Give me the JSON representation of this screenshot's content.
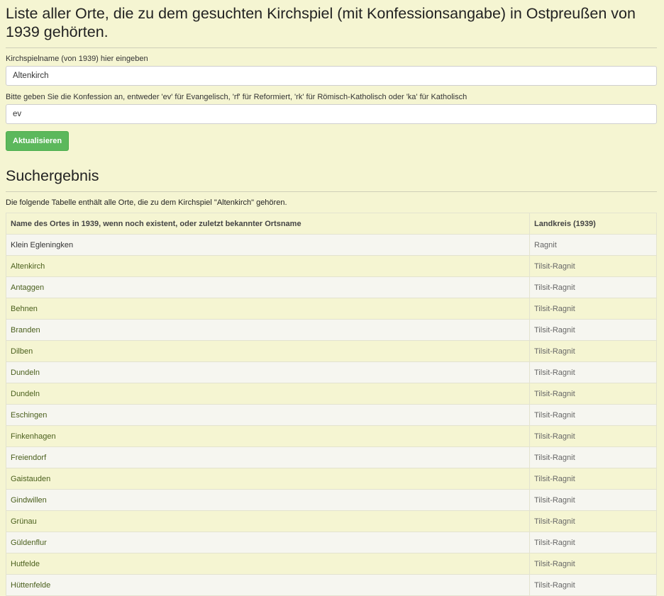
{
  "page": {
    "title": "Liste aller Orte, die zu dem gesuchten Kirchspiel (mit Konfessionsangabe) in Ostpreußen von 1939 gehörten."
  },
  "form": {
    "kirchspiel_label": "Kirchspielname (von 1939) hier eingeben",
    "kirchspiel_value": "Altenkirch",
    "konfession_label": "Bitte geben Sie die Konfession an, entweder 'ev' für Evangelisch, 'rf' für Reformiert, 'rk' für Römisch-Katholisch oder 'ka' für Katholisch",
    "konfession_value": "ev",
    "submit_label": "Aktualisieren"
  },
  "results": {
    "title": "Suchergebnis",
    "intro": "Die folgende Tabelle enthält alle Orte, die zu dem Kirchspiel \"Altenkirch\" gehören.",
    "columns": [
      "Name des Ortes in 1939, wenn noch existent, oder zuletzt bekannter Ortsname",
      "Landkreis (1939)"
    ],
    "rows": [
      {
        "name": "Klein Egleningken",
        "kreis": "Ragnit"
      },
      {
        "name": "Altenkirch",
        "kreis": "Tilsit-Ragnit"
      },
      {
        "name": "Antaggen",
        "kreis": "Tilsit-Ragnit"
      },
      {
        "name": "Behnen",
        "kreis": "Tilsit-Ragnit"
      },
      {
        "name": "Branden",
        "kreis": "Tilsit-Ragnit"
      },
      {
        "name": "Dilben",
        "kreis": "Tilsit-Ragnit"
      },
      {
        "name": "Dundeln",
        "kreis": "Tilsit-Ragnit"
      },
      {
        "name": "Dundeln",
        "kreis": "Tilsit-Ragnit"
      },
      {
        "name": "Eschingen",
        "kreis": "Tilsit-Ragnit"
      },
      {
        "name": "Finkenhagen",
        "kreis": "Tilsit-Ragnit"
      },
      {
        "name": "Freiendorf",
        "kreis": "Tilsit-Ragnit"
      },
      {
        "name": "Gaistauden",
        "kreis": "Tilsit-Ragnit"
      },
      {
        "name": "Gindwillen",
        "kreis": "Tilsit-Ragnit"
      },
      {
        "name": "Grünau",
        "kreis": "Tilsit-Ragnit"
      },
      {
        "name": "Güldenflur",
        "kreis": "Tilsit-Ragnit"
      },
      {
        "name": "Hutfelde",
        "kreis": "Tilsit-Ragnit"
      },
      {
        "name": "Hüttenfelde",
        "kreis": "Tilsit-Ragnit"
      }
    ]
  },
  "colors": {
    "page_background": "#f5f5d2",
    "button": "#5cb85c",
    "link_text": "#4a5f1c"
  }
}
